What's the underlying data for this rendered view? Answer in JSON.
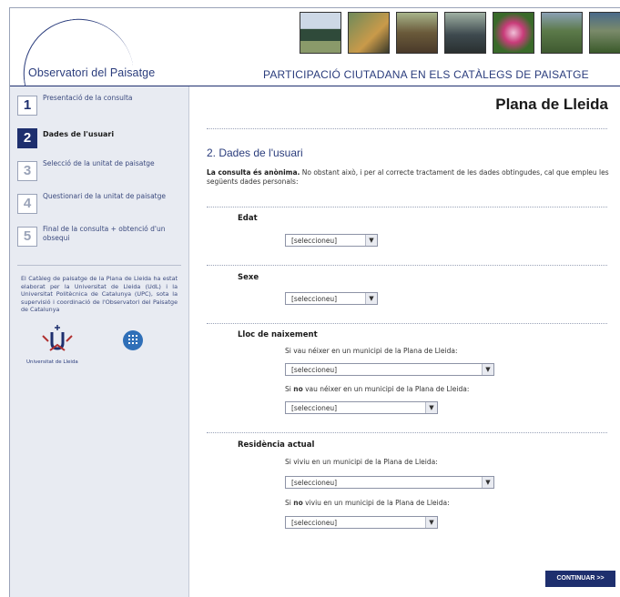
{
  "header": {
    "logo_text": "Observatori del Paisatge",
    "title": "PARTICIPACIÓ CIUTADANA EN ELS CATÀLEGS DE PAISATGE",
    "photos": [
      {
        "name": "tree-photo",
        "colors": [
          "#cdd8e6",
          "#2f4a3a"
        ]
      },
      {
        "name": "people-photo",
        "colors": [
          "#6f8a5a",
          "#c99a4a"
        ]
      },
      {
        "name": "farm-photo",
        "colors": [
          "#6a5a3a",
          "#a7b48a"
        ]
      },
      {
        "name": "building-photo",
        "colors": [
          "#3e4a4f",
          "#9fb0a2"
        ]
      },
      {
        "name": "flower-photo",
        "colors": [
          "#c93c7a",
          "#3a6a2a"
        ]
      },
      {
        "name": "valley-photo",
        "colors": [
          "#5c7a4a",
          "#8aa0b4"
        ]
      },
      {
        "name": "mountain-photo",
        "colors": [
          "#4a6a8a",
          "#3a5a2a"
        ]
      }
    ]
  },
  "sidebar": {
    "steps": [
      {
        "num": "1",
        "label": "Presentació de la consulta",
        "state": "done"
      },
      {
        "num": "2",
        "label": "Dades de l'usuari",
        "state": "active"
      },
      {
        "num": "3",
        "label": "Selecció de la unitat de paisatge",
        "state": "pending"
      },
      {
        "num": "4",
        "label": "Questionari de la unitat de paisatge",
        "state": "pending"
      },
      {
        "num": "5",
        "label": "Final de la consulta + obtenció d'un obsequi",
        "state": "pending"
      }
    ],
    "credits": "El Catàleg de paisatge de la Plana de Lleida ha estat elaborat per la Universitat de Lleida (UdL) i la Universitat Politècnica de Catalunya (UPC), sota la supervisió i coordinació de l'Observatori del Paisatge de Catalunya",
    "udl_caption": "Universitat de Lleida",
    "upc_label": "UPC"
  },
  "main": {
    "page_title": "Plana de Lleida",
    "section_title": "2. Dades de l'usuari",
    "intro_bold": "La consulta és anònima.",
    "intro_rest": " No obstant això, i per al correcte tractament de les dades obtingudes, cal que empleu les següents dades personals:",
    "edat_label": "Edat",
    "sexe_label": "Sexe",
    "naixement_label": "Lloc de naixement",
    "naixement_hint_1": "Si vau néixer en un municipi de la Plana de Lleida:",
    "naixement_hint_2_pre": "Si ",
    "naixement_hint_2_bold": "no",
    "naixement_hint_2_post": " vau néixer en un municipi de la Plana de Lleida:",
    "residencia_label": "Residència actual",
    "residencia_hint_1": "Si viviu en un municipi de la Plana de Lleida:",
    "residencia_hint_2_pre": "Si ",
    "residencia_hint_2_bold": "no",
    "residencia_hint_2_post": " viviu en un municipi de la Plana de Lleida:",
    "select_placeholder": "[seleccioneu]",
    "continue_label": "CONTINUAR >>"
  }
}
